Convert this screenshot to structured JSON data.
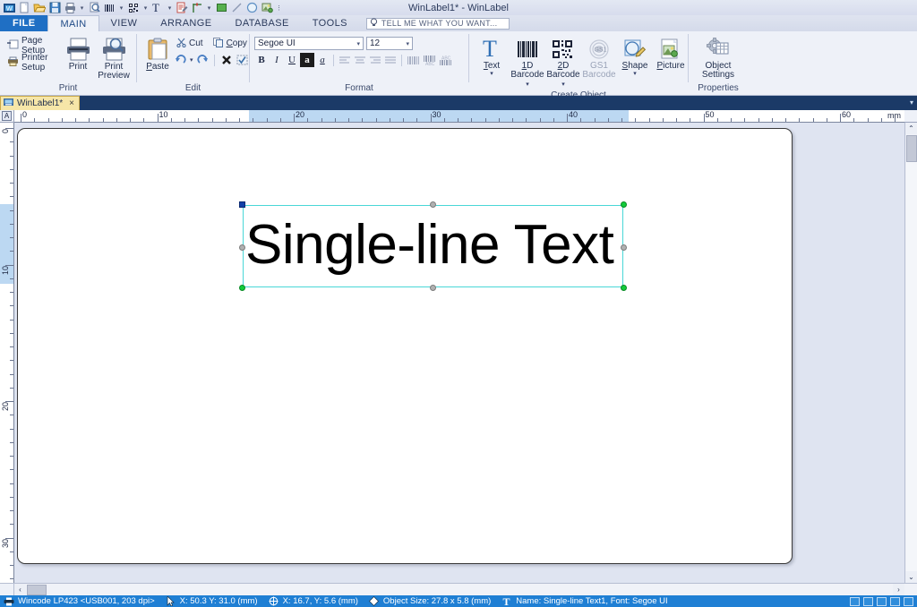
{
  "window": {
    "title": "WinLabel1* - WinLabel"
  },
  "quick_access": {
    "items": [
      {
        "name": "app-logo-icon",
        "label": "WinLabel"
      },
      {
        "name": "new-document-icon",
        "label": "New"
      },
      {
        "name": "open-document-icon",
        "label": "Open"
      },
      {
        "name": "save-icon",
        "label": "Save"
      },
      {
        "name": "print-icon",
        "label": "Print"
      },
      {
        "name": "print-preview-icon",
        "label": "Print Preview"
      },
      {
        "name": "1d-barcode-icon",
        "label": "1D Barcode"
      },
      {
        "name": "2d-barcode-icon",
        "label": "2D Barcode"
      },
      {
        "name": "text-icon",
        "label": "Text"
      },
      {
        "name": "rich-text-icon",
        "label": "Rich Text"
      },
      {
        "name": "line-object-icon",
        "label": "Line Object"
      },
      {
        "name": "rectangle-icon",
        "label": "Rectangle"
      },
      {
        "name": "diagonal-line-icon",
        "label": "Line"
      },
      {
        "name": "ellipse-icon",
        "label": "Ellipse"
      },
      {
        "name": "picture-icon",
        "label": "Picture"
      }
    ],
    "overflow_label": "Customize Quick Access Toolbar"
  },
  "ribbon_tabs": [
    {
      "id": "file",
      "label": "FILE",
      "active": false
    },
    {
      "id": "main",
      "label": "MAIN",
      "active": true
    },
    {
      "id": "view",
      "label": "VIEW",
      "active": false
    },
    {
      "id": "arrange",
      "label": "ARRANGE",
      "active": false
    },
    {
      "id": "database",
      "label": "DATABASE",
      "active": false
    },
    {
      "id": "tools",
      "label": "TOOLS",
      "active": false
    }
  ],
  "tell_me": {
    "placeholder": "TELL ME WHAT YOU WANT...",
    "value": ""
  },
  "ribbon": {
    "groups": [
      {
        "id": "print",
        "title": "Print",
        "small_buttons": [
          {
            "label": "Page Setup",
            "icon": "page-setup-icon"
          },
          {
            "label": "Printer Setup",
            "icon": "printer-setup-icon"
          }
        ],
        "big_buttons": [
          {
            "label": "Print",
            "label2": "",
            "icon": "print-icon",
            "disabled": false
          },
          {
            "label": "Print",
            "label2": "Preview",
            "icon": "print-preview-icon",
            "disabled": false
          }
        ]
      },
      {
        "id": "edit",
        "title": "Edit",
        "big_buttons": [
          {
            "label": "Paste",
            "label2": "",
            "icon": "paste-icon",
            "disabled": false
          }
        ],
        "small_buttons": [
          {
            "label": "Cut",
            "icon": "cut-icon"
          },
          {
            "label": "Copy",
            "icon": "copy-icon"
          }
        ],
        "tool_buttons": [
          {
            "label": "Undo",
            "icon": "undo-icon"
          },
          {
            "label": "Redo",
            "icon": "redo-icon"
          },
          {
            "label": "Delete",
            "icon": "delete-icon"
          },
          {
            "label": "Select",
            "icon": "select-all-icon"
          }
        ]
      },
      {
        "id": "format",
        "title": "Format",
        "font_name": "Segoe UI",
        "font_size": "12",
        "buttons": [
          {
            "id": "bold",
            "glyph": "B",
            "label": "Bold",
            "state": "off",
            "disabled": false
          },
          {
            "id": "italic",
            "glyph": "I",
            "label": "Italic",
            "state": "off",
            "disabled": false
          },
          {
            "id": "underline",
            "glyph": "U",
            "label": "Underline",
            "state": "off",
            "disabled": false
          },
          {
            "id": "invert",
            "glyph": "a",
            "label": "Inverse",
            "state": "on",
            "disabled": false
          },
          {
            "id": "italic-alt",
            "glyph": "a",
            "label": "Italic Character",
            "state": "off",
            "disabled": false
          },
          {
            "id": "align-left",
            "glyph": "",
            "label": "Align Left",
            "state": "off",
            "disabled": true
          },
          {
            "id": "align-center",
            "glyph": "",
            "label": "Align Center",
            "state": "off",
            "disabled": true
          },
          {
            "id": "align-right",
            "glyph": "",
            "label": "Align Right",
            "state": "off",
            "disabled": true
          },
          {
            "id": "align-justify",
            "glyph": "",
            "label": "Justify",
            "state": "off",
            "disabled": true
          },
          {
            "id": "barcode-plain",
            "glyph": "",
            "label": "Barcode Only",
            "state": "off",
            "disabled": true
          },
          {
            "id": "barcode-text",
            "glyph": "",
            "label": "Barcode With Text",
            "state": "off",
            "disabled": true
          },
          {
            "id": "barcode-text-top",
            "glyph": "",
            "label": "Barcode Text On Top",
            "state": "off",
            "disabled": true
          }
        ]
      },
      {
        "id": "create-object",
        "title": "Create Object",
        "big_buttons": [
          {
            "label": "Text",
            "label2": "",
            "icon": "text-object-icon",
            "disabled": false,
            "dropdown": true
          },
          {
            "label": "1D",
            "label2": "Barcode",
            "icon": "1d-barcode-icon",
            "disabled": false,
            "dropdown": true
          },
          {
            "label": "2D",
            "label2": "Barcode",
            "icon": "2d-barcode-icon",
            "disabled": false,
            "dropdown": true
          },
          {
            "label": "GS1",
            "label2": "Barcode",
            "icon": "gs1-barcode-icon",
            "disabled": true,
            "dropdown": false
          },
          {
            "label": "Shape",
            "label2": "",
            "icon": "shape-icon",
            "disabled": false,
            "dropdown": true
          },
          {
            "label": "Picture",
            "label2": "",
            "icon": "picture-icon",
            "disabled": false,
            "dropdown": false
          }
        ]
      },
      {
        "id": "properties",
        "title": "Properties",
        "big_buttons": [
          {
            "label": "Object",
            "label2": "Settings",
            "icon": "object-settings-icon",
            "disabled": false
          }
        ]
      }
    ]
  },
  "document_tabs": [
    {
      "label": "WinLabel1*",
      "icon": "document-icon",
      "close": "×",
      "active": true
    }
  ],
  "rulers": {
    "unit": "mm",
    "corner_glyph": "A",
    "horizontal_labels": [
      "0",
      "10",
      "20",
      "30",
      "40",
      "50",
      "60"
    ],
    "vertical_labels": [
      "0",
      "10",
      "20",
      "30"
    ],
    "h_highlight_start_mm": 16.7,
    "h_highlight_end_mm": 44.5,
    "v_highlight_start_mm": 5.6,
    "v_highlight_end_mm": 11.4
  },
  "canvas": {
    "object": {
      "text": "Single-line Text",
      "name": "Single-line Text1",
      "font": "Segoe UI",
      "selected": true,
      "handles": [
        "top-left-anchor",
        "top-center",
        "top-right",
        "middle-left",
        "middle-right",
        "bottom-left",
        "bottom-center",
        "bottom-right"
      ]
    }
  },
  "status_bar": {
    "printer": "Wincode LP423 <USB001, 203 dpi>",
    "cursor_position": "X: 50.3  Y: 31.0 (mm)",
    "object_position": "X: 16.7, Y: 5.6 (mm)",
    "object_size": "Object Size: 27.8 x 5.8 (mm)",
    "object_info": "Name: Single-line Text1, Font: Segoe UI",
    "view_buttons": [
      "fit-page-icon",
      "design-view-icon",
      "print-preview-icon",
      "grid-view-icon",
      "zoom-icon"
    ]
  },
  "colors": {
    "accent": "#1f7fd4",
    "file_tab": "#1f6fc4",
    "doc_tab_bar": "#1b3a67",
    "doc_tab": "#f6e6a8",
    "ruler_highlight": "#bcd8f2",
    "selection": "#49d7d7",
    "handle_green": "#12cc3a",
    "handle_blue": "#1340a8"
  }
}
